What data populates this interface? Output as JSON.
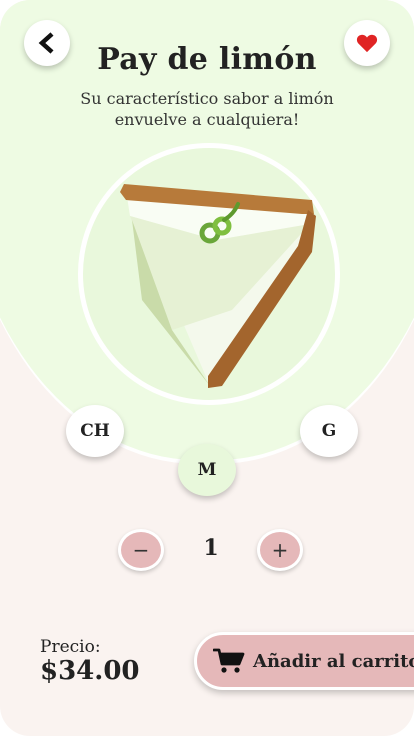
{
  "header": {
    "back_icon": "chevron-left-icon",
    "favorite_icon": "heart-icon",
    "title": "Pay de limón",
    "subtitle": "Su característico sabor a limón envuelve a cualquiera!"
  },
  "product": {
    "image": "key-lime-pie-slice"
  },
  "sizes": {
    "options": [
      "CH",
      "M",
      "G"
    ],
    "selected": "M"
  },
  "quantity": {
    "minus_label": "−",
    "value": "1",
    "plus_label": "+"
  },
  "footer": {
    "price_label": "Precio:",
    "price_value": "$34.00",
    "cart_icon": "cart-icon",
    "add_to_cart_label": "Añadir al carrito"
  },
  "colors": {
    "background": "#faf3f0",
    "top_panel": "#eefbe3",
    "selected_size": "#e8f8db",
    "accent": "#e5b8b9",
    "heart": "#e02424"
  }
}
